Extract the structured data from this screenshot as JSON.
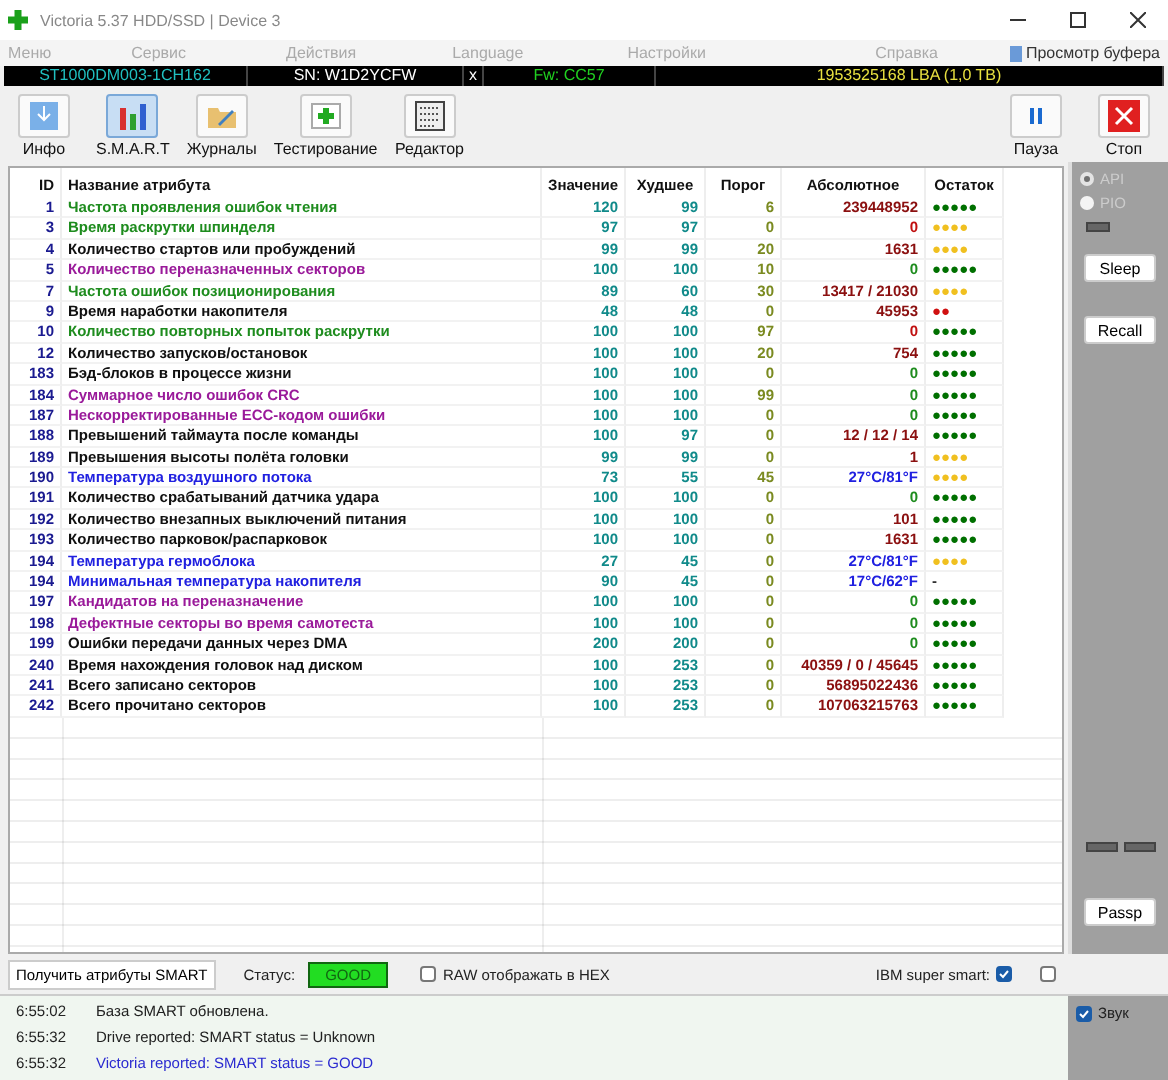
{
  "window": {
    "title": "Victoria 5.37 HDD/SSD | Device 3"
  },
  "menu": [
    "Меню",
    "Сервис",
    "Действия",
    "Language",
    "Настройки",
    "Справка"
  ],
  "buffer_button": "Просмотр буфера",
  "drive_bar": {
    "model": "ST1000DM003-1CH162",
    "serial": "SN: W1D2YCFW",
    "close": "x",
    "firmware": "Fw: CC57",
    "capacity": "1953525168 LBA (1,0 TB)"
  },
  "toolbar": [
    {
      "label": "Инфо",
      "kind": "info",
      "selected": false
    },
    {
      "label": "S.M.A.R.T",
      "kind": "smart",
      "selected": true
    },
    {
      "label": "Журналы",
      "kind": "logs",
      "selected": false
    },
    {
      "label": "Тестирование",
      "kind": "test",
      "selected": false
    },
    {
      "label": "Редактор",
      "kind": "editor",
      "selected": false
    }
  ],
  "actions": [
    {
      "label": "Пауза",
      "kind": "pause"
    },
    {
      "label": "Стоп",
      "kind": "stop"
    }
  ],
  "table": {
    "columns": [
      "ID",
      "Название атрибута",
      "Значение",
      "Худшее",
      "Порог",
      "Абсолютное",
      "Остаток"
    ],
    "rows": [
      {
        "id": "1",
        "name": "Частота проявления ошибок чтения",
        "color": "#1e8c1e",
        "value": "120",
        "worst": "99",
        "threshold": "6",
        "absolute": {
          "text": "239448952",
          "color": "#8b1010"
        },
        "remainder": {
          "text": "●●●●●",
          "color": "#007000"
        }
      },
      {
        "id": "3",
        "name": "Время раскрутки шпинделя",
        "color": "#1e8c1e",
        "value": "97",
        "worst": "97",
        "threshold": "0",
        "absolute": {
          "text": "0",
          "color": "#c01010"
        },
        "remainder": {
          "text": "●●●●",
          "color": "#f0c020"
        }
      },
      {
        "id": "4",
        "name": "Количество стартов или пробуждений",
        "color": "#101010",
        "value": "99",
        "worst": "99",
        "threshold": "20",
        "absolute": {
          "text": "1631",
          "color": "#8b1010"
        },
        "remainder": {
          "text": "●●●●",
          "color": "#f0c020"
        }
      },
      {
        "id": "5",
        "name": "Количество переназначенных секторов",
        "color": "#9a1a9a",
        "value": "100",
        "worst": "100",
        "threshold": "10",
        "absolute": {
          "text": "0",
          "color": "#1e8c1e"
        },
        "remainder": {
          "text": "●●●●●",
          "color": "#007000"
        }
      },
      {
        "id": "7",
        "name": "Частота ошибок позиционирования",
        "color": "#1e8c1e",
        "value": "89",
        "worst": "60",
        "threshold": "30",
        "absolute": {
          "text": "13417 / 21030",
          "color": "#8b1010"
        },
        "remainder": {
          "text": "●●●●",
          "color": "#f0c020"
        }
      },
      {
        "id": "9",
        "name": "Время наработки накопителя",
        "color": "#101010",
        "value": "48",
        "worst": "48",
        "threshold": "0",
        "absolute": {
          "text": "45953",
          "color": "#8b1010"
        },
        "remainder": {
          "text": "●●",
          "color": "#d01010"
        }
      },
      {
        "id": "10",
        "name": "Количество повторных попыток раскрутки",
        "color": "#1e8c1e",
        "value": "100",
        "worst": "100",
        "threshold": "97",
        "absolute": {
          "text": "0",
          "color": "#c01010"
        },
        "remainder": {
          "text": "●●●●●",
          "color": "#007000"
        }
      },
      {
        "id": "12",
        "name": "Количество запусков/остановок",
        "color": "#101010",
        "value": "100",
        "worst": "100",
        "threshold": "20",
        "absolute": {
          "text": "754",
          "color": "#8b1010"
        },
        "remainder": {
          "text": "●●●●●",
          "color": "#007000"
        }
      },
      {
        "id": "183",
        "name": "Бэд-блоков в процессе жизни",
        "color": "#101010",
        "value": "100",
        "worst": "100",
        "threshold": "0",
        "absolute": {
          "text": "0",
          "color": "#1e8c1e"
        },
        "remainder": {
          "text": "●●●●●",
          "color": "#007000"
        }
      },
      {
        "id": "184",
        "name": "Суммарное число ошибок CRC",
        "color": "#9a1a9a",
        "value": "100",
        "worst": "100",
        "threshold": "99",
        "absolute": {
          "text": "0",
          "color": "#1e8c1e"
        },
        "remainder": {
          "text": "●●●●●",
          "color": "#007000"
        }
      },
      {
        "id": "187",
        "name": "Нескорректированные ECC-кодом ошибки",
        "color": "#9a1a9a",
        "value": "100",
        "worst": "100",
        "threshold": "0",
        "absolute": {
          "text": "0",
          "color": "#1e8c1e"
        },
        "remainder": {
          "text": "●●●●●",
          "color": "#007000"
        }
      },
      {
        "id": "188",
        "name": "Превышений таймаута после команды",
        "color": "#101010",
        "value": "100",
        "worst": "97",
        "threshold": "0",
        "absolute": {
          "text": "12 / 12 / 14",
          "color": "#8b1010"
        },
        "remainder": {
          "text": "●●●●●",
          "color": "#007000"
        }
      },
      {
        "id": "189",
        "name": "Превышения высоты полёта головки",
        "color": "#101010",
        "value": "99",
        "worst": "99",
        "threshold": "0",
        "absolute": {
          "text": "1",
          "color": "#8b1010"
        },
        "remainder": {
          "text": "●●●●",
          "color": "#f0c020"
        }
      },
      {
        "id": "190",
        "name": "Температура воздушного потока",
        "color": "#2020e0",
        "value": "73",
        "worst": "55",
        "threshold": "45",
        "absolute": {
          "text": "27°C/81°F",
          "color": "#2020e0"
        },
        "remainder": {
          "text": "●●●●",
          "color": "#f0c020"
        }
      },
      {
        "id": "191",
        "name": "Количество срабатываний датчика удара",
        "color": "#101010",
        "value": "100",
        "worst": "100",
        "threshold": "0",
        "absolute": {
          "text": "0",
          "color": "#1e8c1e"
        },
        "remainder": {
          "text": "●●●●●",
          "color": "#007000"
        }
      },
      {
        "id": "192",
        "name": "Количество внезапных выключений питания",
        "color": "#101010",
        "value": "100",
        "worst": "100",
        "threshold": "0",
        "absolute": {
          "text": "101",
          "color": "#8b1010"
        },
        "remainder": {
          "text": "●●●●●",
          "color": "#007000"
        }
      },
      {
        "id": "193",
        "name": "Количество парковок/распарковок",
        "color": "#101010",
        "value": "100",
        "worst": "100",
        "threshold": "0",
        "absolute": {
          "text": "1631",
          "color": "#8b1010"
        },
        "remainder": {
          "text": "●●●●●",
          "color": "#007000"
        }
      },
      {
        "id": "194",
        "name": "Температура гермоблока",
        "color": "#2020e0",
        "value": "27",
        "worst": "45",
        "threshold": "0",
        "absolute": {
          "text": "27°C/81°F",
          "color": "#2020e0"
        },
        "remainder": {
          "text": "●●●●",
          "color": "#f0c020"
        }
      },
      {
        "id": "194",
        "name": "Минимальная температура накопителя",
        "color": "#2020e0",
        "value": "90",
        "worst": "45",
        "threshold": "0",
        "absolute": {
          "text": "17°C/62°F",
          "color": "#2020e0"
        },
        "remainder": {
          "text": "-",
          "color": "#303030"
        }
      },
      {
        "id": "197",
        "name": "Кандидатов на переназначение",
        "color": "#9a1a9a",
        "value": "100",
        "worst": "100",
        "threshold": "0",
        "absolute": {
          "text": "0",
          "color": "#1e8c1e"
        },
        "remainder": {
          "text": "●●●●●",
          "color": "#007000"
        }
      },
      {
        "id": "198",
        "name": "Дефектные секторы во время самотеста",
        "color": "#9a1a9a",
        "value": "100",
        "worst": "100",
        "threshold": "0",
        "absolute": {
          "text": "0",
          "color": "#1e8c1e"
        },
        "remainder": {
          "text": "●●●●●",
          "color": "#007000"
        }
      },
      {
        "id": "199",
        "name": "Ошибки передачи данных через DMA",
        "color": "#101010",
        "value": "200",
        "worst": "200",
        "threshold": "0",
        "absolute": {
          "text": "0",
          "color": "#1e8c1e"
        },
        "remainder": {
          "text": "●●●●●",
          "color": "#007000"
        }
      },
      {
        "id": "240",
        "name": "Время нахождения головок над диском",
        "color": "#101010",
        "value": "100",
        "worst": "253",
        "threshold": "0",
        "absolute": {
          "text": "40359 / 0 / 45645",
          "color": "#8b1010"
        },
        "remainder": {
          "text": "●●●●●",
          "color": "#007000"
        }
      },
      {
        "id": "241",
        "name": "Всего записано секторов",
        "color": "#101010",
        "value": "100",
        "worst": "253",
        "threshold": "0",
        "absolute": {
          "text": "56895022436",
          "color": "#8b1010"
        },
        "remainder": {
          "text": "●●●●●",
          "color": "#007000"
        }
      },
      {
        "id": "242",
        "name": "Всего прочитано секторов",
        "color": "#101010",
        "value": "100",
        "worst": "253",
        "threshold": "0",
        "absolute": {
          "text": "107063215763",
          "color": "#8b1010"
        },
        "remainder": {
          "text": "●●●●●",
          "color": "#007000"
        }
      }
    ]
  },
  "side_panel": {
    "radios": [
      {
        "label": "API",
        "selected": true
      },
      {
        "label": "PIO",
        "selected": false
      }
    ],
    "buttons": [
      "Sleep",
      "Recall"
    ],
    "bottom_button": "Passp"
  },
  "status_bar": {
    "get_button": "Получить атрибуты SMART",
    "status_label": "Статус:",
    "status": "GOOD",
    "raw_hex": {
      "label": "RAW отображать в HEX",
      "checked": false
    },
    "ibm": {
      "label": "IBM super smart:",
      "checked": true
    },
    "extra_checked": false
  },
  "log": [
    {
      "time": "6:55:02",
      "message": "База SMART обновлена.",
      "color": "#202020"
    },
    {
      "time": "6:55:32",
      "message": "Drive reported: SMART status = Unknown",
      "color": "#202020"
    },
    {
      "time": "6:55:32",
      "message": "Victoria reported: SMART status = GOOD",
      "color": "#2a2ad0"
    }
  ],
  "sound": {
    "label": "Звук",
    "checked": true
  }
}
